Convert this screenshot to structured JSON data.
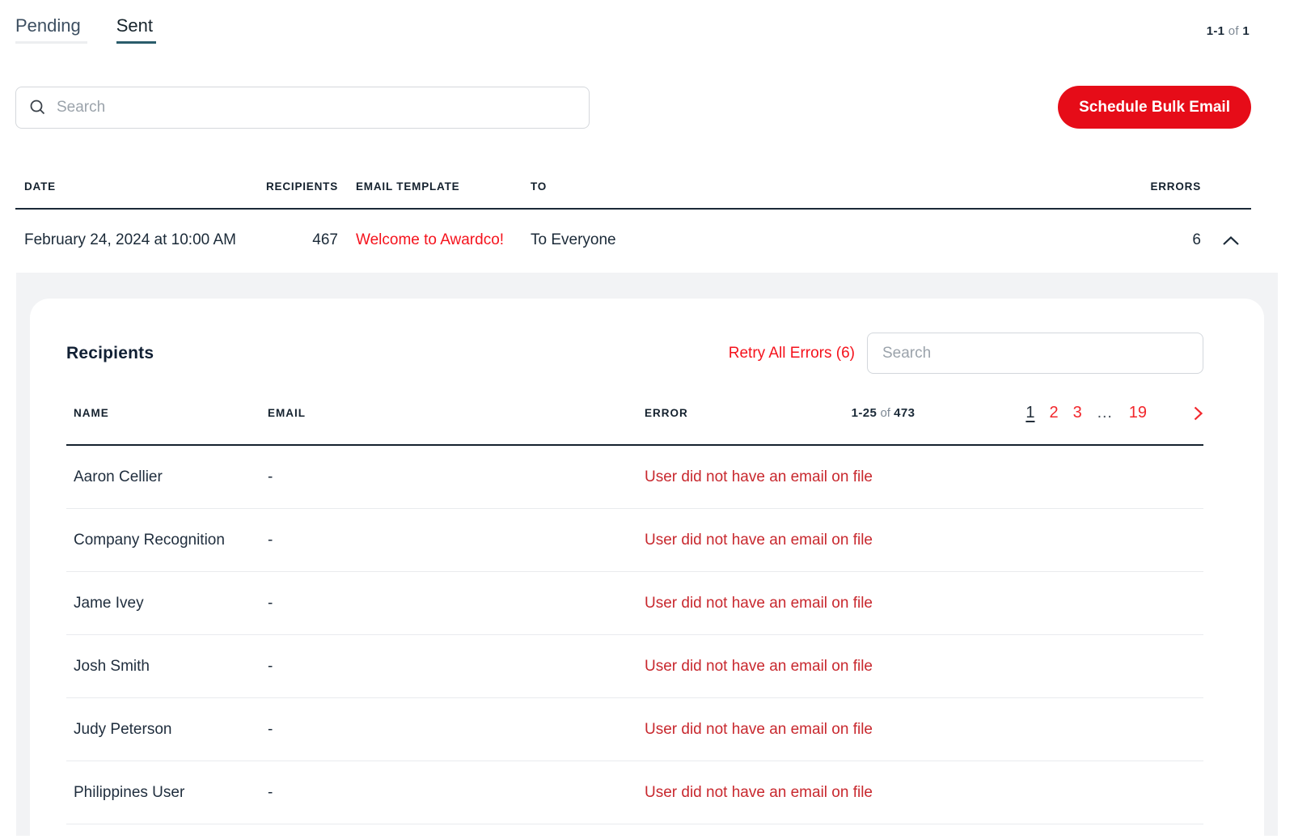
{
  "tabs": {
    "pending": "Pending",
    "sent": "Sent"
  },
  "results_count": {
    "range": "1-1",
    "of_label": "of",
    "total": "1"
  },
  "toolbar": {
    "search_placeholder": "Search",
    "schedule_button_label": "Schedule Bulk Email"
  },
  "sent_table": {
    "headers": {
      "date": "DATE",
      "recipients": "RECIPIENTS",
      "template": "EMAIL TEMPLATE",
      "to": "TO",
      "errors": "ERRORS"
    },
    "row": {
      "date": "February 24, 2024 at 10:00 AM",
      "recipients": "467",
      "template": "Welcome to Awardco!",
      "to": "To Everyone",
      "errors": "6"
    }
  },
  "recipients_panel": {
    "title": "Recipients",
    "retry_all_label": "Retry All Errors (6)",
    "search_placeholder": "Search",
    "table": {
      "headers": {
        "name": "NAME",
        "email": "EMAIL",
        "error": "ERROR"
      },
      "range": {
        "shown": "1-25",
        "of_label": "of",
        "total": "473"
      },
      "pagination": {
        "current": "1",
        "page_2": "2",
        "page_3": "3",
        "ellipsis": "…",
        "last": "19"
      },
      "rows": [
        {
          "name": "Aaron Cellier",
          "email": "-",
          "error": "User did not have an email on file"
        },
        {
          "name": "Company Recognition",
          "email": "-",
          "error": "User did not have an email on file"
        },
        {
          "name": "Jame Ivey",
          "email": "-",
          "error": "User did not have an email on file"
        },
        {
          "name": "Josh Smith",
          "email": "-",
          "error": "User did not have an email on file"
        },
        {
          "name": "Judy Peterson",
          "email": "-",
          "error": "User did not have an email on file"
        },
        {
          "name": "Philippines User",
          "email": "-",
          "error": "User did not have an email on file"
        }
      ]
    }
  },
  "colors": {
    "brand_red": "#e60c18",
    "link_red": "#f5121c",
    "pagination_red": "#f2272c",
    "error_red": "#c8282e",
    "dark_text": "#1b2a38",
    "active_tab_underline": "#2a5c6b",
    "panel_gray": "#f2f3f5"
  }
}
